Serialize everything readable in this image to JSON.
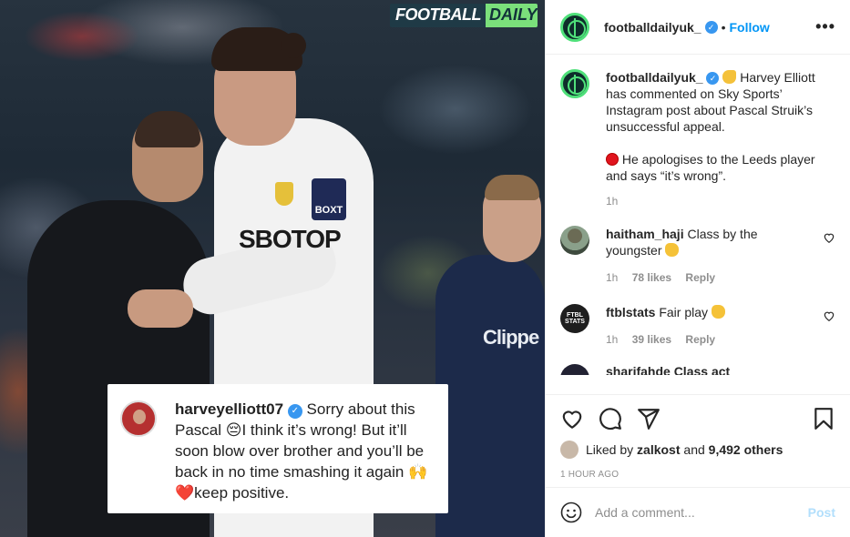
{
  "photo": {
    "logo_part1": "FOOTBALL",
    "logo_part2": "DAILY",
    "sponsor_text": "SBOTOP",
    "badge_text": "BOXT",
    "coach_text": "Clippe",
    "quote": {
      "username": "harveyelliott07",
      "text": "Sorry about this Pascal 😔I think it’s wrong! But it’ll soon blow over brother and you’ll be back in no time smashing it again 🙌❤️keep positive."
    }
  },
  "header": {
    "username": "footballdailyuk_",
    "dot": "•",
    "follow_label": "Follow",
    "more_label": "•••"
  },
  "caption": {
    "username": "footballdailyuk_",
    "line1": "Harvey Elliott has commented on Sky Sports’ Instagram post about Pascal Struik’s unsuccessful appeal.",
    "line2": "He apologises to the Leeds player and says “it’s wrong”.",
    "time": "1h"
  },
  "comments": [
    {
      "username": "haitham_haji",
      "text": "Class by the youngster",
      "time": "1h",
      "likes": "78 likes",
      "reply": "Reply"
    },
    {
      "username": "ftblstats",
      "text": "Fair play",
      "time": "1h",
      "likes": "39 likes",
      "reply": "Reply",
      "avatar_text": "FTBL STATS"
    }
  ],
  "partial_comment": "sharifahde  Class act",
  "actions": {
    "liked_prefix": "Liked by",
    "liked_user": "zalkost",
    "liked_and": "and",
    "liked_count": "9,492 others",
    "time_ago": "1 HOUR AGO"
  },
  "add_comment": {
    "placeholder": "Add a comment...",
    "post_label": "Post"
  },
  "colors": {
    "link": "#0095f6",
    "muted": "#8e8e8e",
    "post_disabled": "#b2dffc",
    "brand_green": "#4fe07a"
  }
}
